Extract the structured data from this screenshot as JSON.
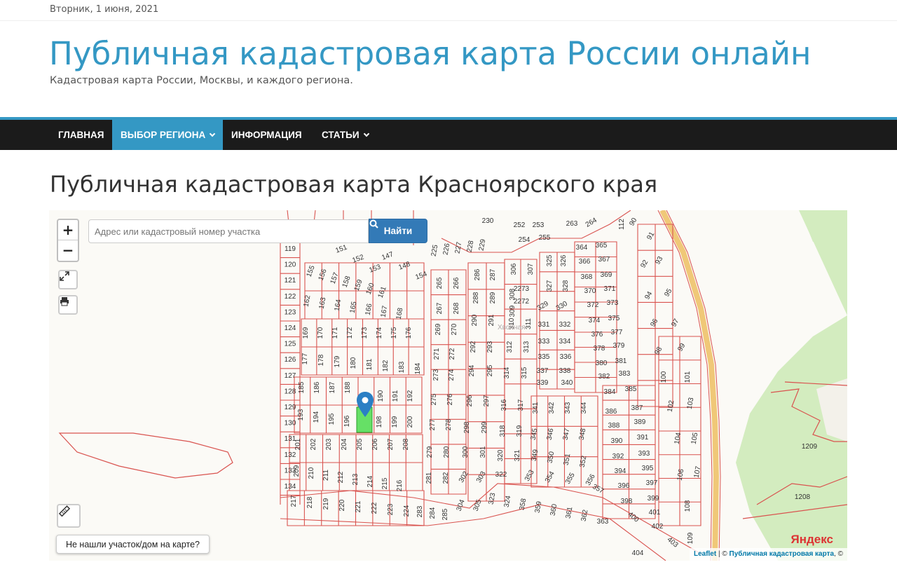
{
  "header": {
    "date": "Вторник, 1 июня, 2021",
    "site_title": "Публичная кадастровая карта России онлайн",
    "site_description": "Кадастровая карта России, Москвы, и каждого региона."
  },
  "nav": {
    "items": [
      {
        "label": "ГЛАВНАЯ",
        "dropdown": false,
        "active": false
      },
      {
        "label": "ВЫБОР РЕГИОНА",
        "dropdown": true,
        "active": true
      },
      {
        "label": "ИНФОРМАЦИЯ",
        "dropdown": false,
        "active": false
      },
      {
        "label": "СТАТЬИ",
        "dropdown": true,
        "active": false
      }
    ]
  },
  "page": {
    "title": "Публичная кадастровая карта Красноярского края"
  },
  "map": {
    "search": {
      "placeholder": "Адрес или кадастровый номер участка",
      "button_label": "Найти",
      "button_icon": "search-icon"
    },
    "controls": {
      "zoom_in": "+",
      "zoom_out": "−",
      "fullscreen_icon": "expand-icon",
      "print_icon": "print-icon",
      "ruler_icon": "ruler-icon"
    },
    "not_found_button": "Не нашли участок/дом на карте?",
    "attribution": {
      "leaflet": "Leaflet",
      "separator": " | © ",
      "source": "Публичная кадастровая карта",
      "suffix": ", ©"
    },
    "yandex_logo": "Яндекс",
    "colors": {
      "parcel_line": "#d9534f",
      "selected_parcel": "#66e066",
      "green_area": "#cfe8b8",
      "road": "#f0c878",
      "marker": "#2b7fc4"
    },
    "parcel_labels": [
      {
        "text": "119"
      },
      {
        "text": "120"
      },
      {
        "text": "121"
      },
      {
        "text": "122"
      },
      {
        "text": "123"
      },
      {
        "text": "124"
      },
      {
        "text": "125"
      },
      {
        "text": "126"
      },
      {
        "text": "127"
      },
      {
        "text": "128"
      },
      {
        "text": "129"
      },
      {
        "text": "130"
      },
      {
        "text": "131"
      },
      {
        "text": "132"
      },
      {
        "text": "133"
      },
      {
        "text": "134"
      },
      {
        "text": "155"
      },
      {
        "text": "156"
      },
      {
        "text": "157"
      },
      {
        "text": "158"
      },
      {
        "text": "159"
      },
      {
        "text": "160"
      },
      {
        "text": "161"
      },
      {
        "text": "162"
      },
      {
        "text": "163"
      },
      {
        "text": "164"
      },
      {
        "text": "165"
      },
      {
        "text": "166"
      },
      {
        "text": "167"
      },
      {
        "text": "168"
      },
      {
        "text": "169"
      },
      {
        "text": "170"
      },
      {
        "text": "171"
      },
      {
        "text": "172"
      },
      {
        "text": "173"
      },
      {
        "text": "174"
      },
      {
        "text": "175"
      },
      {
        "text": "176"
      },
      {
        "text": "177"
      },
      {
        "text": "178"
      },
      {
        "text": "179"
      },
      {
        "text": "180"
      },
      {
        "text": "181"
      },
      {
        "text": "182"
      },
      {
        "text": "183"
      },
      {
        "text": "184"
      },
      {
        "text": "185"
      },
      {
        "text": "186"
      },
      {
        "text": "187"
      },
      {
        "text": "188"
      },
      {
        "text": "190"
      },
      {
        "text": "191"
      },
      {
        "text": "192"
      },
      {
        "text": "193"
      },
      {
        "text": "194"
      },
      {
        "text": "195"
      },
      {
        "text": "196"
      },
      {
        "text": "198"
      },
      {
        "text": "199"
      },
      {
        "text": "200"
      },
      {
        "text": "201"
      },
      {
        "text": "202"
      },
      {
        "text": "203"
      },
      {
        "text": "204"
      },
      {
        "text": "205"
      },
      {
        "text": "206"
      },
      {
        "text": "207"
      },
      {
        "text": "208"
      },
      {
        "text": "209"
      },
      {
        "text": "210"
      },
      {
        "text": "211"
      },
      {
        "text": "212"
      },
      {
        "text": "213"
      },
      {
        "text": "214"
      },
      {
        "text": "215"
      },
      {
        "text": "216"
      },
      {
        "text": "217"
      },
      {
        "text": "218"
      },
      {
        "text": "219"
      },
      {
        "text": "220"
      },
      {
        "text": "221"
      },
      {
        "text": "222"
      },
      {
        "text": "223"
      },
      {
        "text": "224"
      },
      {
        "text": "151"
      },
      {
        "text": "152"
      },
      {
        "text": "153"
      },
      {
        "text": "147"
      },
      {
        "text": "148"
      },
      {
        "text": "154"
      },
      {
        "text": "225"
      },
      {
        "text": "226"
      },
      {
        "text": "227"
      },
      {
        "text": "228"
      },
      {
        "text": "229"
      },
      {
        "text": "230"
      },
      {
        "text": "252"
      },
      {
        "text": "253"
      },
      {
        "text": "254"
      },
      {
        "text": "255"
      },
      {
        "text": "263"
      },
      {
        "text": "264"
      },
      {
        "text": "265"
      },
      {
        "text": "266"
      },
      {
        "text": "267"
      },
      {
        "text": "268"
      },
      {
        "text": "269"
      },
      {
        "text": "270"
      },
      {
        "text": "271"
      },
      {
        "text": "272"
      },
      {
        "text": "273"
      },
      {
        "text": "274"
      },
      {
        "text": "275"
      },
      {
        "text": "276"
      },
      {
        "text": "277"
      },
      {
        "text": "278"
      },
      {
        "text": "279"
      },
      {
        "text": "280"
      },
      {
        "text": "281"
      },
      {
        "text": "282"
      },
      {
        "text": "283"
      },
      {
        "text": "284"
      },
      {
        "text": "285"
      },
      {
        "text": "286"
      },
      {
        "text": "287"
      },
      {
        "text": "288"
      },
      {
        "text": "289"
      },
      {
        "text": "290"
      },
      {
        "text": "291"
      },
      {
        "text": "292"
      },
      {
        "text": "293"
      },
      {
        "text": "294"
      },
      {
        "text": "295"
      },
      {
        "text": "296"
      },
      {
        "text": "297"
      },
      {
        "text": "298"
      },
      {
        "text": "299"
      },
      {
        "text": "300"
      },
      {
        "text": "301"
      },
      {
        "text": "302"
      },
      {
        "text": "303"
      },
      {
        "text": "304"
      },
      {
        "text": "305"
      },
      {
        "text": "306"
      },
      {
        "text": "307"
      },
      {
        "text": "308"
      },
      {
        "text": "309"
      },
      {
        "text": "310"
      },
      {
        "text": "311"
      },
      {
        "text": "312"
      },
      {
        "text": "313"
      },
      {
        "text": "314"
      },
      {
        "text": "315"
      },
      {
        "text": "316"
      },
      {
        "text": "317"
      },
      {
        "text": "318"
      },
      {
        "text": "319"
      },
      {
        "text": "320"
      },
      {
        "text": "321"
      },
      {
        "text": "322"
      },
      {
        "text": "323"
      },
      {
        "text": "324"
      },
      {
        "text": "325"
      },
      {
        "text": "326"
      },
      {
        "text": "327"
      },
      {
        "text": "328"
      },
      {
        "text": "329"
      },
      {
        "text": "330"
      },
      {
        "text": "331"
      },
      {
        "text": "332"
      },
      {
        "text": "333"
      },
      {
        "text": "334"
      },
      {
        "text": "335"
      },
      {
        "text": "336"
      },
      {
        "text": "337"
      },
      {
        "text": "338"
      },
      {
        "text": "339"
      },
      {
        "text": "340"
      },
      {
        "text": "341"
      },
      {
        "text": "342"
      },
      {
        "text": "343"
      },
      {
        "text": "344"
      },
      {
        "text": "345"
      },
      {
        "text": "346"
      },
      {
        "text": "347"
      },
      {
        "text": "348"
      },
      {
        "text": "349"
      },
      {
        "text": "350"
      },
      {
        "text": "351"
      },
      {
        "text": "352"
      },
      {
        "text": "353"
      },
      {
        "text": "354"
      },
      {
        "text": "355"
      },
      {
        "text": "356"
      },
      {
        "text": "357"
      },
      {
        "text": "358"
      },
      {
        "text": "359"
      },
      {
        "text": "360"
      },
      {
        "text": "361"
      },
      {
        "text": "362"
      },
      {
        "text": "363"
      },
      {
        "text": "364"
      },
      {
        "text": "365"
      },
      {
        "text": "366"
      },
      {
        "text": "367"
      },
      {
        "text": "368"
      },
      {
        "text": "369"
      },
      {
        "text": "370"
      },
      {
        "text": "371"
      },
      {
        "text": "372"
      },
      {
        "text": "373"
      },
      {
        "text": "374"
      },
      {
        "text": "375"
      },
      {
        "text": "376"
      },
      {
        "text": "377"
      },
      {
        "text": "378"
      },
      {
        "text": "379"
      },
      {
        "text": "380"
      },
      {
        "text": "381"
      },
      {
        "text": "382"
      },
      {
        "text": "383"
      },
      {
        "text": "384"
      },
      {
        "text": "385"
      },
      {
        "text": "386"
      },
      {
        "text": "387"
      },
      {
        "text": "388"
      },
      {
        "text": "389"
      },
      {
        "text": "390"
      },
      {
        "text": "391"
      },
      {
        "text": "392"
      },
      {
        "text": "393"
      },
      {
        "text": "394"
      },
      {
        "text": "395"
      },
      {
        "text": "396"
      },
      {
        "text": "397"
      },
      {
        "text": "398"
      },
      {
        "text": "399"
      },
      {
        "text": "400"
      },
      {
        "text": "401"
      },
      {
        "text": "402"
      },
      {
        "text": "403"
      },
      {
        "text": "404"
      },
      {
        "text": "2272"
      },
      {
        "text": "2273"
      },
      {
        "text": "90"
      },
      {
        "text": "91"
      },
      {
        "text": "92"
      },
      {
        "text": "93"
      },
      {
        "text": "94"
      },
      {
        "text": "95"
      },
      {
        "text": "96"
      },
      {
        "text": "97"
      },
      {
        "text": "98"
      },
      {
        "text": "99"
      },
      {
        "text": "100"
      },
      {
        "text": "101"
      },
      {
        "text": "102"
      },
      {
        "text": "103"
      },
      {
        "text": "104"
      },
      {
        "text": "105"
      },
      {
        "text": "106"
      },
      {
        "text": "107"
      },
      {
        "text": "108"
      },
      {
        "text": "109"
      },
      {
        "text": "112"
      },
      {
        "text": "1208"
      },
      {
        "text": "1209"
      }
    ]
  }
}
